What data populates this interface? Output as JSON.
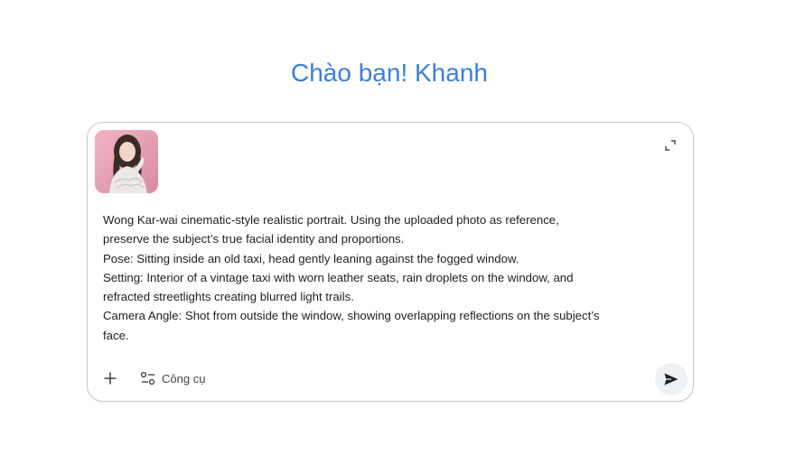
{
  "greeting": "Chào bạn! Khanh",
  "composer": {
    "attachment": {
      "kind": "uploaded-photo-thumbnail"
    },
    "prompt_text": "Wong Kar-wai cinematic-style realistic portrait. Using the uploaded photo as reference,\npreserve the subject’s true facial identity and proportions.\nPose: Sitting inside an old taxi, head gently leaning against the fogged window.\nSetting: Interior of a vintage taxi with worn leather seats, rain droplets on the window, and\nrefracted streetlights creating blurred light trails.\nCamera Angle: Shot from outside the window, showing overlapping reflections on the subject’s\nface.",
    "tools_label": "Công cụ",
    "icons": {
      "expand": "expand-icon",
      "add": "plus-icon",
      "tools": "tools-icon",
      "send": "send-icon"
    }
  },
  "colors": {
    "greeting": "#3e7fd6",
    "border": "#c6c9ce",
    "send_bg": "#eef1f6",
    "text": "#1f1f1f"
  }
}
